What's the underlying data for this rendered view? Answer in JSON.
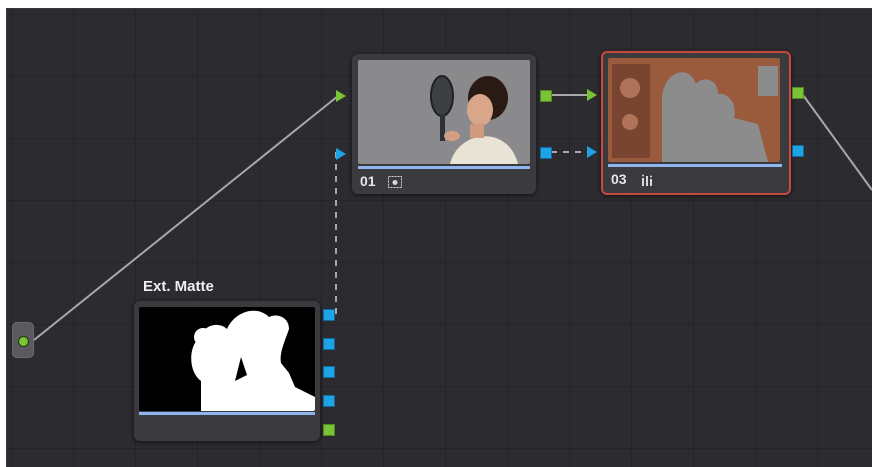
{
  "colors": {
    "canvas": "#2b2b30",
    "grid": "#24242a",
    "node": "#3b3b3f",
    "selected_outline": "#c64a3c",
    "port_green": "#7ac236",
    "port_blue": "#1ea3e6",
    "wire": "#a8a8a8"
  },
  "nodes": {
    "node01": {
      "number": "01",
      "badge_icon": "node-cache-icon"
    },
    "node03": {
      "number": "03",
      "badge_icon": "parade-icon",
      "selected": true
    },
    "ext_matte": {
      "label": "Ext. Matte"
    }
  },
  "source_input": {
    "icon": "source-input-icon"
  }
}
